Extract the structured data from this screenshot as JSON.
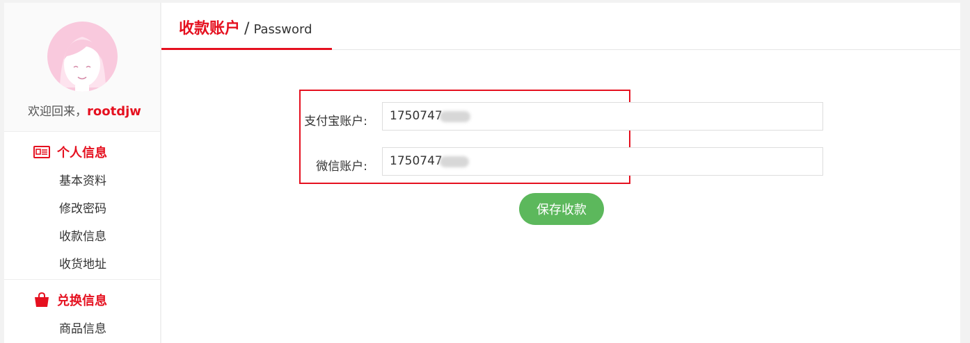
{
  "sidebar": {
    "welcome_prefix": "欢迎回来，",
    "username": "rootdjw",
    "groups": [
      {
        "title": "个人信息",
        "icon": "id-card-icon",
        "items": [
          "基本资料",
          "修改密码",
          "收款信息",
          "收货地址"
        ]
      },
      {
        "title": "兑换信息",
        "icon": "shopping-bag-icon",
        "items": [
          "商品信息"
        ]
      }
    ]
  },
  "header": {
    "title_cn": "收款账户",
    "separator": "/",
    "title_en": "Password"
  },
  "form": {
    "alipay_label": "支付宝账户:",
    "alipay_value": "1750747",
    "wechat_label": "微信账户:",
    "wechat_value": "1750747",
    "save_label": "保存收款"
  },
  "colors": {
    "accent": "#e5101f",
    "save_button": "#5cb85c",
    "highlight_box": "#e5101f"
  }
}
